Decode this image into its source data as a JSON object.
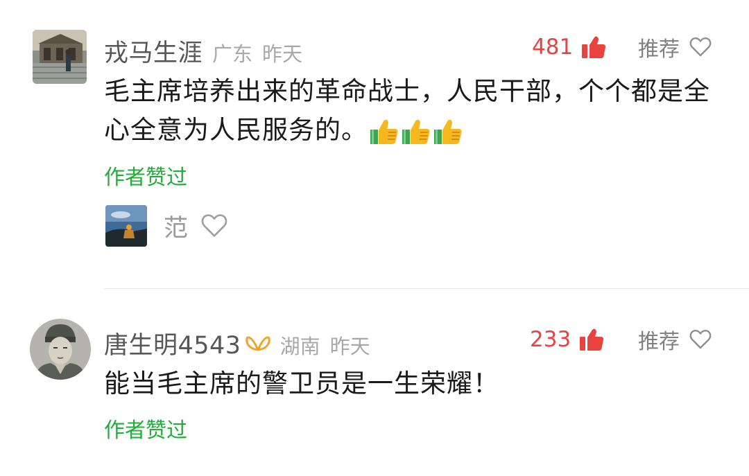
{
  "comments": [
    {
      "username": "戎马生涯",
      "location": "广东",
      "time": "昨天",
      "likes": "481",
      "recommend_label": "推荐",
      "text": "毛主席培养出来的革命战士，人民干部，个个都是全心全意为人民服务的。",
      "emoji": [
        "thumbs-up",
        "thumbs-up",
        "thumbs-up"
      ],
      "author_liked": "作者赞过",
      "reply": {
        "name": "范"
      }
    },
    {
      "username": "唐生明4543",
      "location": "湖南",
      "time": "昨天",
      "likes": "233",
      "recommend_label": "推荐",
      "text": "能当毛主席的警卫员是一生荣耀！",
      "author_liked": "作者赞过"
    }
  ],
  "colors": {
    "like_red": "#e8433f",
    "author_green": "#22ad38",
    "meta_gray": "#a8a8a8"
  }
}
